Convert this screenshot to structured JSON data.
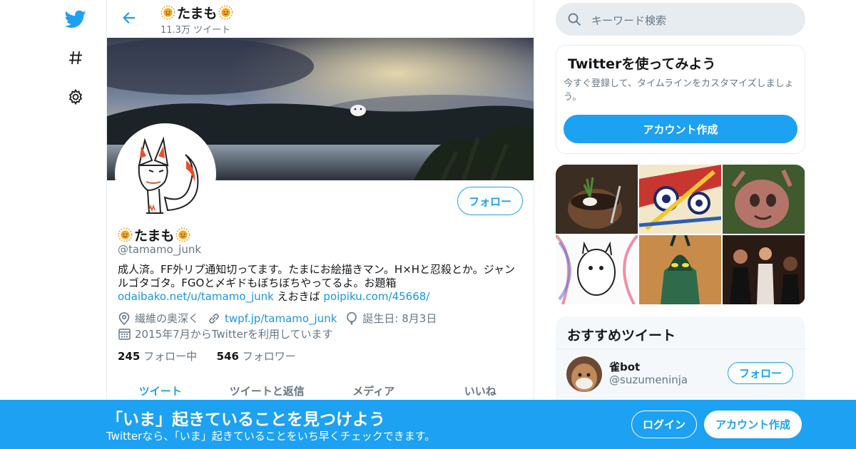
{
  "colors": {
    "accent": "#1da1f2",
    "text": "#14171a",
    "secondary": "#657786",
    "divider": "#e6ecf0"
  },
  "nav": {
    "icons": [
      "twitter-bird-icon",
      "hashtag-icon",
      "gear-icon"
    ]
  },
  "header": {
    "display_name": "たまも",
    "tweet_count": "11.3万 ツイート"
  },
  "profile": {
    "display_name": "たまも",
    "handle": "@tamamo_junk",
    "follow_label": "フォロー",
    "bio_text": "成人済。FF外リプ通知切ってます。たまにお絵描きマン。H×Hと忍殺とか。ジャンルゴタゴタ。FGOと〆ギドもぼちぼちやってるよ。お題箱",
    "bio_link1": "odaibako.net/u/tamamo_junk",
    "bio_mid": " えおきば ",
    "bio_link2": "poipiku.com/45668/",
    "location": "繊維の奥深く",
    "website": "twpf.jp/tamamo_junk",
    "birthday": "誕生日: 8月3日",
    "joined": "2015年7月からTwitterを利用しています",
    "following_count": "245",
    "following_label": "フォロー中",
    "followers_count": "546",
    "followers_label": "フォロワー"
  },
  "tabs": [
    {
      "label": "ツイート",
      "active": true
    },
    {
      "label": "ツイートと返信",
      "active": false
    },
    {
      "label": "メディア",
      "active": false
    },
    {
      "label": "いいね",
      "active": false
    }
  ],
  "search": {
    "placeholder": "キーワード検索"
  },
  "signup_card": {
    "title": "Twitterを使ってみよう",
    "text": "今すぐ登録して、タイムラインをカスタマイズしましょう。",
    "button": "アカウント作成"
  },
  "recommended": {
    "title": "おすすめツイート",
    "users": [
      {
        "name": "雀bot",
        "handle": "@suzumeninja",
        "follow_label": "フォロー"
      }
    ]
  },
  "bottom_bar": {
    "title": "「いま」起きていることを見つけよう",
    "subtitle": "Twitterなら、「いま」起きていることをいち早くチェックできます。",
    "login": "ログイン",
    "signup": "アカウント作成"
  }
}
